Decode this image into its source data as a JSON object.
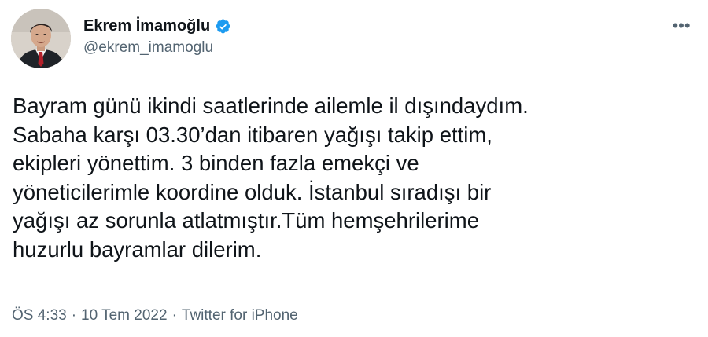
{
  "user": {
    "display_name": "Ekrem İmamoğlu",
    "handle": "@ekrem_imamoglu",
    "verified": true,
    "avatar_icon": "profile-photo"
  },
  "tweet": {
    "text": "Bayram günü ikindi saatlerinde ailemle il dışındaydım.\nSabaha karşı 03.30’dan itibaren yağışı takip ettim,\nekipleri yönettim. 3 binden fazla emekçi ve\nyöneticilerimle koordine olduk. İstanbul sıradışı bir\nyağışı az sorunla atlatmıştır.Tüm hemşehrilerime\nhuzurlu bayramlar dilerim.",
    "time": "ÖS 4:33",
    "date": "10 Tem 2022",
    "source": "Twitter for iPhone",
    "separator": "·"
  },
  "menu": {
    "more_label": "•••",
    "more_icon": "more-horizontal-icon"
  },
  "colors": {
    "text": "#0f1419",
    "secondary": "#536471",
    "verified": "#1d9bf0"
  }
}
